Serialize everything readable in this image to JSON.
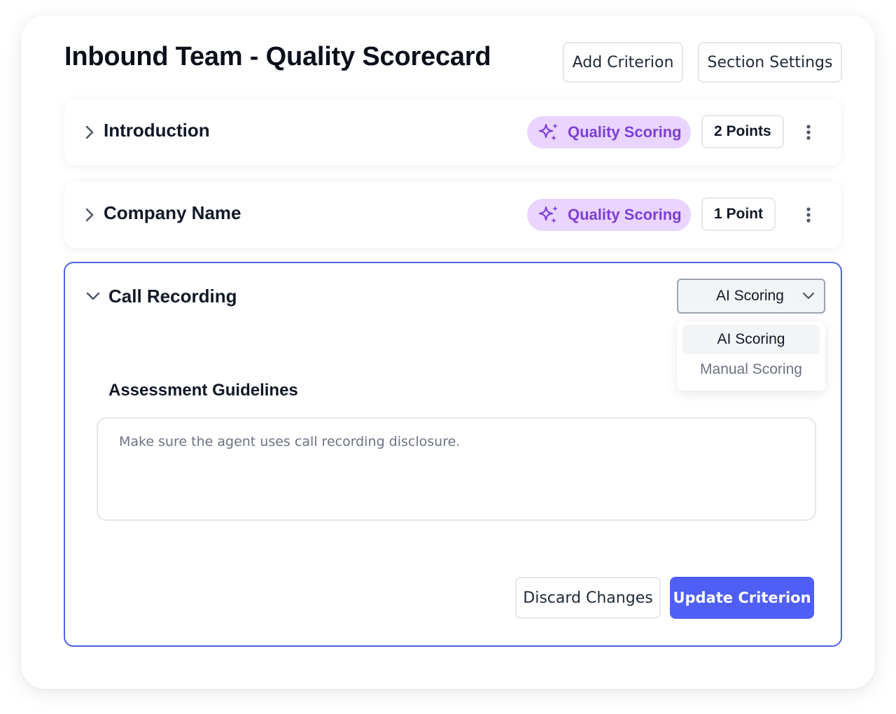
{
  "header": {
    "title": "Inbound Team - Quality Scorecard",
    "add_label": "Add Criterion",
    "settings_label": "Section Settings"
  },
  "criteria": [
    {
      "title": "Introduction",
      "badge": "Quality Scoring",
      "points": "2 Points",
      "expanded": false
    },
    {
      "title": "Company Name",
      "badge": "Quality Scoring",
      "points": "1 Point",
      "expanded": false
    },
    {
      "title": "Call Recording",
      "expanded": true,
      "scoring_select": {
        "value": "AI Scoring",
        "options": [
          "AI Scoring",
          "Manual Scoring"
        ],
        "highlighted": "AI Scoring"
      },
      "guidelines_label": "Assessment Guidelines",
      "guidelines_text": "Make sure the agent uses call recording disclosure.",
      "discard_label": "Discard Changes",
      "update_label": "Update Criterion"
    }
  ],
  "colors": {
    "accent": "#4f5ef5",
    "active_border": "#4f63e0",
    "badge_bg": "#e9d5ff",
    "badge_text": "#7e3fd6"
  },
  "icons": {
    "expand_collapsed": "chevron-right-icon",
    "expand_open": "chevron-down-icon",
    "badge": "sparkles-icon",
    "menu": "more-vertical-icon",
    "select": "chevron-down-icon"
  }
}
